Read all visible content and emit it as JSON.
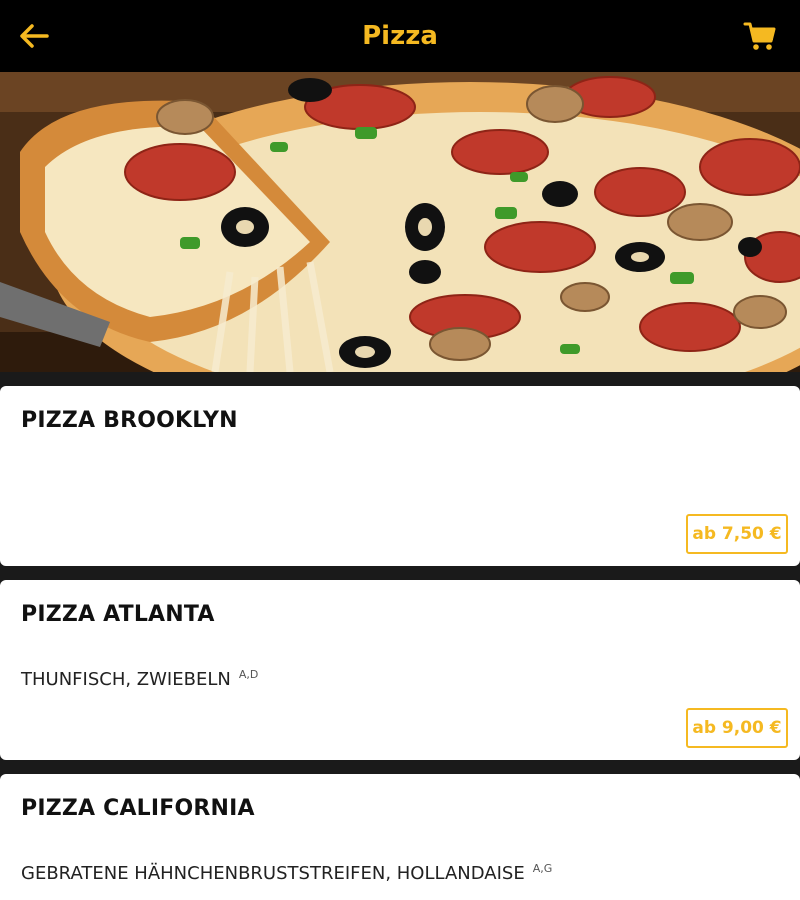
{
  "colors": {
    "accent": "#F5B921",
    "header_bg": "#000000",
    "card_bg": "#FFFFFF"
  },
  "header": {
    "title": "Pizza",
    "back_icon": "arrow-left-icon",
    "cart_icon": "shopping-cart-icon"
  },
  "hero": {
    "alt": "pizza"
  },
  "menu": {
    "items": [
      {
        "name": "PIZZA BROOKLYN",
        "description": "",
        "allergens": "",
        "price": "ab 7,50 €"
      },
      {
        "name": "PIZZA ATLANTA",
        "description": "THUNFISCH, ZWIEBELN",
        "allergens": "A,D",
        "price": "ab 9,00 €"
      },
      {
        "name": "PIZZA CALIFORNIA",
        "description": "GEBRATENE HÄHNCHENBRUSTSTREIFEN, HOLLANDAISE",
        "allergens": "A,G",
        "price": ""
      }
    ]
  }
}
